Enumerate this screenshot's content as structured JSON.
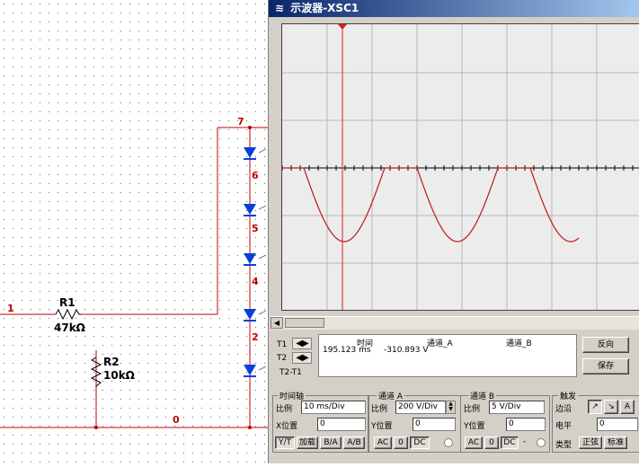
{
  "schematic": {
    "resistor1": {
      "name": "R1",
      "value": "47kΩ"
    },
    "resistor2": {
      "name": "R2",
      "value": "10kΩ"
    },
    "node_labels": [
      "1",
      "7",
      "6",
      "5",
      "4",
      "2",
      "0"
    ],
    "wire_color": "#c00000",
    "led_color": "#0a3fd8"
  },
  "scope": {
    "title": "示波器-XSC1",
    "trace_color": "#c01818",
    "cursor_color": "#e02020",
    "readout": {
      "t1_label": "T1",
      "t2_label": "T2",
      "diff_label": "T2-T1",
      "col_time": "时间",
      "col_a": "通道_A",
      "col_b": "通道_B",
      "t1_time": "195.123 ms",
      "t1_a": "-310.893 V"
    },
    "buttons": {
      "reverse": "反向",
      "save": "保存"
    },
    "timebase": {
      "title": "时间轴",
      "scale_label": "比例",
      "scale_value": "10 ms/Div",
      "xpos_label": "X位置",
      "xpos_value": "0",
      "modes": [
        "Y/T",
        "加载",
        "B/A",
        "A/B"
      ]
    },
    "channel_a": {
      "title": "通道 A",
      "scale_label": "比例",
      "scale_value": "200  V/Div",
      "ypos_label": "Y位置",
      "ypos_value": "0",
      "coupling": [
        "AC",
        "0",
        "DC"
      ]
    },
    "channel_b": {
      "title": "通道 B",
      "scale_label": "比例",
      "scale_value": "5  V/Div",
      "ypos_label": "Y位置",
      "ypos_value": "0",
      "coupling": [
        "AC",
        "0",
        "DC",
        "-"
      ]
    },
    "trigger": {
      "title": "触发",
      "edge_label": "边沿",
      "level_label": "电平",
      "level_value": "0",
      "type_label": "类型",
      "type_buttons": [
        "正弦",
        "标准"
      ]
    }
  }
}
